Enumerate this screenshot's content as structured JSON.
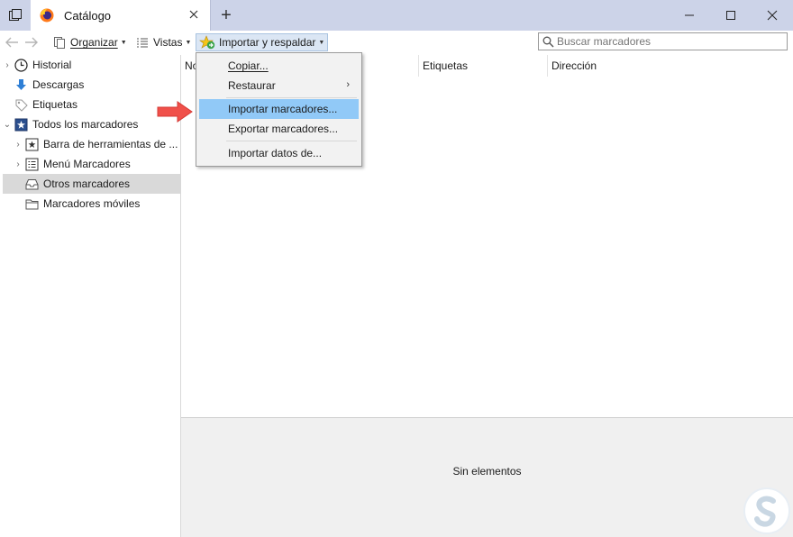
{
  "titlebar": {
    "tab_title": "Catálogo",
    "new_tab_symbol": "+",
    "colors": {
      "bar": "#ccd3e8",
      "tab": "#ffffff"
    }
  },
  "toolbar": {
    "back_icon": "back-arrow-icon",
    "forward_icon": "forward-arrow-icon",
    "organize_label": "Organizar",
    "views_label": "Vistas",
    "import_label": "Importar y respaldar",
    "search_placeholder": "Buscar marcadores"
  },
  "sidebar": {
    "items": [
      {
        "label": "Historial",
        "icon": "clock-icon"
      },
      {
        "label": "Descargas",
        "icon": "download-icon"
      },
      {
        "label": "Etiquetas",
        "icon": "tag-icon"
      },
      {
        "label": "Todos los marcadores",
        "icon": "bookmarks-star-icon"
      },
      {
        "label": "Barra de herramientas de ...",
        "icon": "star-box-icon"
      },
      {
        "label": "Menú Marcadores",
        "icon": "list-icon"
      },
      {
        "label": "Otros marcadores",
        "icon": "tray-icon",
        "selected": true
      },
      {
        "label": "Marcadores móviles",
        "icon": "folder-icon"
      }
    ]
  },
  "columns": {
    "name": "No",
    "tags": "Etiquetas",
    "address": "Dirección"
  },
  "details": {
    "empty_text": "Sin elementos"
  },
  "menu": {
    "items": [
      {
        "label": "Copiar..."
      },
      {
        "label": "Restaurar",
        "submenu_glyph": "›"
      },
      {
        "label": "Importar marcadores...",
        "highlighted": true
      },
      {
        "label": "Exportar marcadores..."
      },
      {
        "label": "Importar datos de..."
      }
    ],
    "highlight_color": "#91c9f7"
  },
  "annotation": {
    "arrow_color": "#f0504a"
  }
}
